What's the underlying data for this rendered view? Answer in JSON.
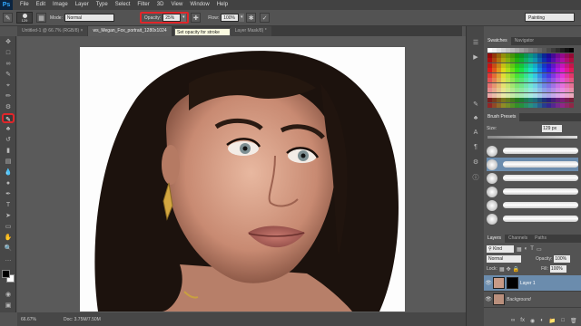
{
  "app": {
    "logo": "Ps"
  },
  "menu": [
    "File",
    "Edit",
    "Image",
    "Layer",
    "Type",
    "Select",
    "Filter",
    "3D",
    "View",
    "Window",
    "Help"
  ],
  "options": {
    "brush_size": "129",
    "mode_label": "Mode:",
    "mode_value": "Normal",
    "opacity_label": "Opacity:",
    "opacity_value": "25%",
    "flow_label": "Flow:",
    "flow_value": "100%",
    "tooltip": "Set opacity for stroke",
    "workspace": "Painting"
  },
  "tabs": [
    {
      "label": "Untitled-1 @ 66.7% (RGB/8) ×",
      "active": false
    },
    {
      "label": "ws_Megan_Fox_portrait_1280x1024",
      "active": true
    },
    {
      "label": "Layer Mask/8) *",
      "active": false
    }
  ],
  "status": {
    "zoom": "66.67%",
    "doc": "Doc: 3.75M/7.50M"
  },
  "panels": {
    "swatches_tab": "Swatches",
    "navigator_tab": "Navigator",
    "brush_presets_tab": "Brush Presets",
    "size_label": "Size:",
    "size_value": "129 px",
    "layers_tab": "Layers",
    "channels_tab": "Channels",
    "paths_tab": "Paths",
    "kind_label": "Kind",
    "blend_mode": "Normal",
    "opacity_label": "Opacity:",
    "opacity_value": "100%",
    "lock_label": "Lock:",
    "fill_label": "Fill:",
    "fill_value": "100%"
  },
  "layers": [
    {
      "name": "Layer 1",
      "selected": true
    },
    {
      "name": "Background",
      "selected": false
    }
  ],
  "colors": {
    "accent_highlight": "#e0262a",
    "selected_layer": "#6b8cad",
    "swatch_bg": "#535353"
  },
  "icons": [
    "move",
    "marquee",
    "lasso",
    "quick-select",
    "crop",
    "eyedropper",
    "healing",
    "brush",
    "clone",
    "history",
    "eraser",
    "gradient",
    "blur",
    "dodge",
    "pen",
    "type",
    "path-select",
    "shape",
    "hand",
    "zoom"
  ]
}
